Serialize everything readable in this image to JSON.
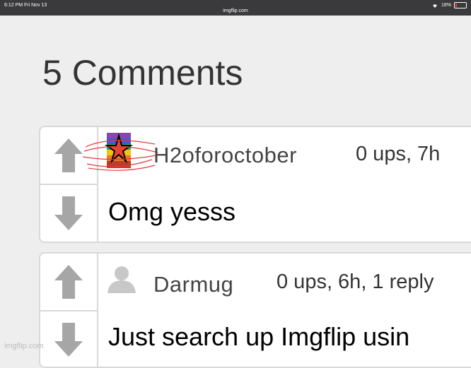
{
  "status_bar": {
    "time": "6:12 PM  Fri Nov 13",
    "url": "imgflip.com",
    "battery": "18%"
  },
  "heading": "5 Comments",
  "comments": [
    {
      "username": "H2oforoctober",
      "meta": "0 ups, 7h",
      "text": "Omg yesss"
    },
    {
      "username": "Darmug",
      "meta": "0 ups, 6h, 1 reply",
      "text": "Just search up Imgflip usin"
    }
  ],
  "watermark": "imgflip.com",
  "colors": {
    "arrow": "#a6a6a6",
    "border": "#d9d9d9",
    "background": "#eeeeee"
  },
  "icons": {
    "upvote": "arrow-up-icon",
    "downvote": "arrow-down-icon",
    "avatar_custom": "rainbow-star-avatar",
    "avatar_default": "person-silhouette-icon"
  }
}
